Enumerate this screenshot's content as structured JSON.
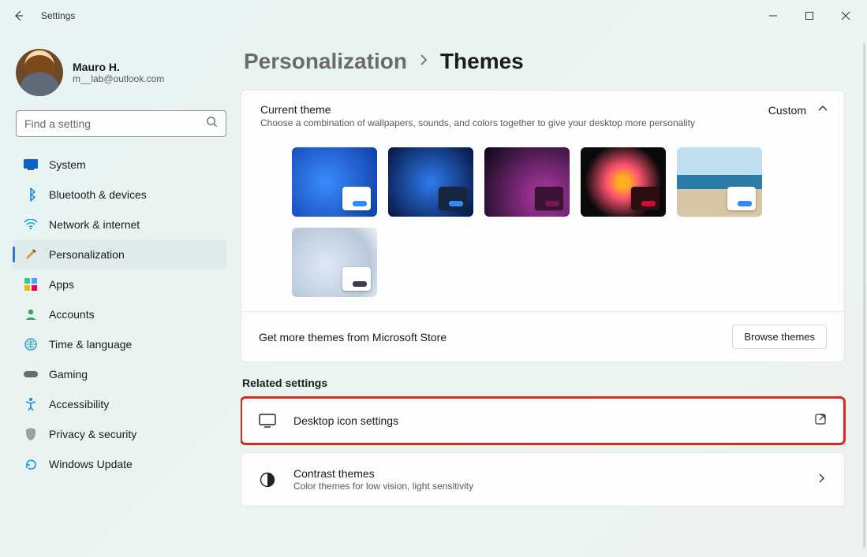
{
  "app": {
    "title": "Settings"
  },
  "profile": {
    "name": "Mauro H.",
    "email": "m__lab@outlook.com"
  },
  "search": {
    "placeholder": "Find a setting"
  },
  "sidebar": {
    "items": [
      {
        "label": "System",
        "icon": "system"
      },
      {
        "label": "Bluetooth & devices",
        "icon": "bluetooth"
      },
      {
        "label": "Network & internet",
        "icon": "network"
      },
      {
        "label": "Personalization",
        "icon": "personalization"
      },
      {
        "label": "Apps",
        "icon": "apps"
      },
      {
        "label": "Accounts",
        "icon": "accounts"
      },
      {
        "label": "Time & language",
        "icon": "timelang"
      },
      {
        "label": "Gaming",
        "icon": "gaming"
      },
      {
        "label": "Accessibility",
        "icon": "accessibility"
      },
      {
        "label": "Privacy & security",
        "icon": "privacy"
      },
      {
        "label": "Windows Update",
        "icon": "update"
      }
    ],
    "active_index": 3
  },
  "breadcrumb": {
    "parent": "Personalization",
    "current": "Themes"
  },
  "current_theme": {
    "heading": "Current theme",
    "description": "Choose a combination of wallpapers, sounds, and colors together to give your desktop more personality",
    "value": "Custom",
    "themes_count": 6,
    "footer_text": "Get more themes from Microsoft Store",
    "browse_button": "Browse themes"
  },
  "related": {
    "heading": "Related settings",
    "rows": [
      {
        "title": "Desktop icon settings",
        "subtitle": "",
        "icon": "monitor",
        "action": "external",
        "highlighted": true
      },
      {
        "title": "Contrast themes",
        "subtitle": "Color themes for low vision, light sensitivity",
        "icon": "contrast",
        "action": "chevron",
        "highlighted": false
      }
    ]
  }
}
